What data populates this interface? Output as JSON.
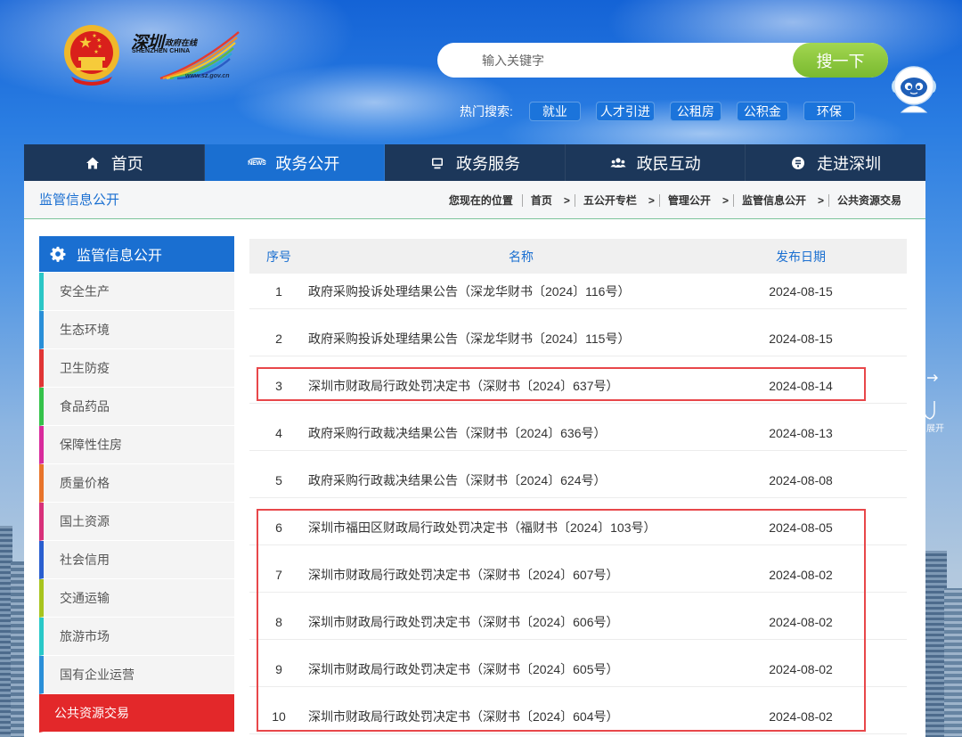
{
  "colors": {
    "accent": "#1a6fd1",
    "nav_bg": "#1c375a",
    "active_red": "#e3282a",
    "search_button": "#8cc53f",
    "annotation": "#e8474a"
  },
  "header": {
    "logo": {
      "emblem_icon": "national-emblem-icon",
      "calligraphy": "深圳",
      "tagline": "政府在线",
      "english": "SHENZHEN CHINA",
      "url": "www.sz.gov.cn"
    },
    "search": {
      "placeholder": "输入关键字",
      "button_label": "搜一下"
    },
    "hot_search": {
      "label": "热门搜索:",
      "tags": [
        "就业",
        "人才引进",
        "公租房",
        "公积金",
        "环保"
      ]
    },
    "mascot_icon": "robot-mascot-icon"
  },
  "nav": {
    "active_index": 1,
    "items": [
      {
        "label": "首页",
        "icon": "home-icon"
      },
      {
        "label": "政务公开",
        "icon": "news-icon",
        "badge": "NEWS"
      },
      {
        "label": "政务服务",
        "icon": "monitor-icon"
      },
      {
        "label": "政民互动",
        "icon": "people-icon"
      },
      {
        "label": "走进深圳",
        "icon": "info-icon"
      }
    ]
  },
  "breadcrumb": {
    "section_title": "监管信息公开",
    "label": "您现在的位置",
    "separator": ">",
    "items": [
      "首页",
      "五公开专栏",
      "管理公开",
      "监管信息公开",
      "公共资源交易"
    ]
  },
  "sidebar": {
    "title": "监管信息公开",
    "title_icon": "gear-icon",
    "active_index": 11,
    "items": [
      {
        "label": "安全生产",
        "color": "#2bc6c6"
      },
      {
        "label": "生态环境",
        "color": "#2a8fd8"
      },
      {
        "label": "卫生防疫",
        "color": "#e03535"
      },
      {
        "label": "食品药品",
        "color": "#34c24a"
      },
      {
        "label": "保障性住房",
        "color": "#d82a9c"
      },
      {
        "label": "质量价格",
        "color": "#e8742a"
      },
      {
        "label": "国土资源",
        "color": "#d8307a"
      },
      {
        "label": "社会信用",
        "color": "#2a5fd0"
      },
      {
        "label": "交通运输",
        "color": "#a8c41e"
      },
      {
        "label": "旅游市场",
        "color": "#29c8c8"
      },
      {
        "label": "国有企业运营",
        "color": "#2a8fd8"
      },
      {
        "label": "公共资源交易",
        "color": "#e3282a"
      }
    ]
  },
  "table": {
    "columns": [
      "序号",
      "名称",
      "发布日期"
    ],
    "rows": [
      {
        "index": "1",
        "title": "政府采购投诉处理结果公告（深龙华财书〔2024〕116号）",
        "date": "2024-08-15"
      },
      {
        "index": "2",
        "title": "政府采购投诉处理结果公告（深龙华财书〔2024〕115号）",
        "date": "2024-08-15"
      },
      {
        "index": "3",
        "title": "深圳市财政局行政处罚决定书（深财书〔2024〕637号）",
        "date": "2024-08-14"
      },
      {
        "index": "4",
        "title": "政府采购行政裁决结果公告（深财书〔2024〕636号）",
        "date": "2024-08-13"
      },
      {
        "index": "5",
        "title": "政府采购行政裁决结果公告（深财书〔2024〕624号）",
        "date": "2024-08-08"
      },
      {
        "index": "6",
        "title": "深圳市福田区财政局行政处罚决定书（福财书〔2024〕103号）",
        "date": "2024-08-05"
      },
      {
        "index": "7",
        "title": "深圳市财政局行政处罚决定书（深财书〔2024〕607号）",
        "date": "2024-08-02"
      },
      {
        "index": "8",
        "title": "深圳市财政局行政处罚决定书（深财书〔2024〕606号）",
        "date": "2024-08-02"
      },
      {
        "index": "9",
        "title": "深圳市财政局行政处罚决定书（深财书〔2024〕605号）",
        "date": "2024-08-02"
      },
      {
        "index": "10",
        "title": "深圳市财政局行政处罚决定书（深财书〔2024〕604号）",
        "date": "2024-08-02"
      }
    ]
  },
  "annotations": {
    "groups": [
      {
        "from": 3,
        "to": 3
      },
      {
        "from": 6,
        "to": 10
      }
    ]
  },
  "float_panel": {
    "arrow_icon": "arrow-right-icon",
    "shield_icon": "shield-icon",
    "expand_label": "展开"
  }
}
